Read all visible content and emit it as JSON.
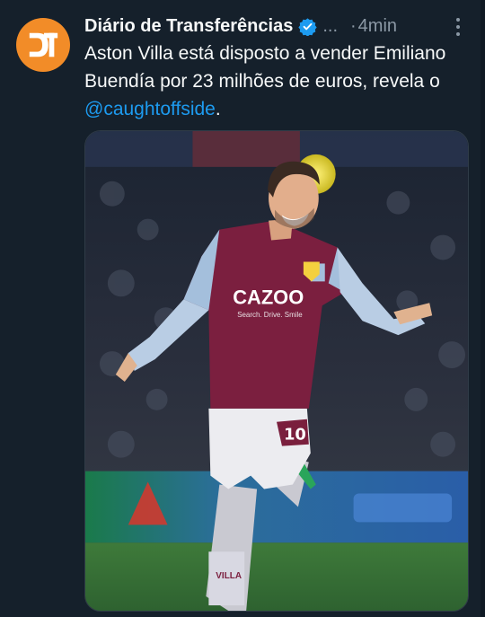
{
  "tweet": {
    "display_name": "Diário de Transferências",
    "handle_ellipsis": "...",
    "separator": "·",
    "time": "4min",
    "text_before": "Aston Villa está disposto a vender Emiliano Buendía por 23 milhões de euros, revela o ",
    "mention": "@caughtoffside",
    "text_after": ".",
    "avatar_letters": "DT",
    "kit_sponsor": "CAZOO",
    "kit_sponsor_sub": "Search. Drive. Smile",
    "shirt_number": "10",
    "sock_text": "VILLA"
  },
  "colors": {
    "background": "#15202b",
    "avatar": "#f28c28",
    "link": "#1d9bf0",
    "verified": "#1d9bf0",
    "muted": "#8b98a5"
  },
  "icons": {
    "verified": "verified-badge-icon",
    "more": "more-options-icon"
  }
}
